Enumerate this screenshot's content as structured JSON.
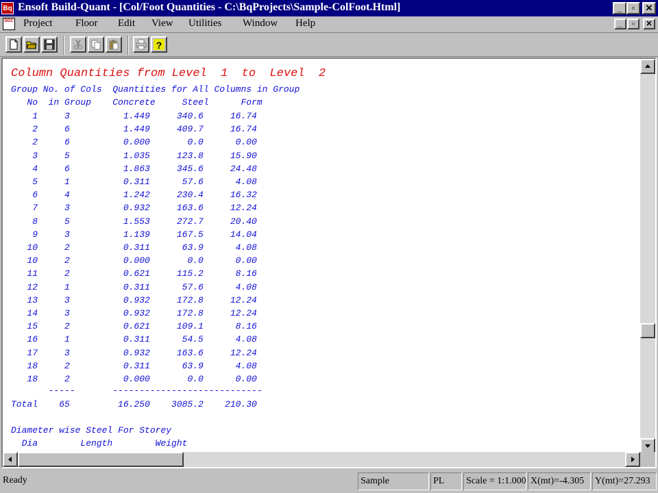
{
  "window": {
    "app_icon_label": "Bq",
    "title": "Ensoft Build-Quant - [Col/Foot Quantities - C:\\BqProjects\\Sample-ColFoot.Html]",
    "minimize": "_",
    "restore": "▫",
    "close": "✕"
  },
  "menu": {
    "doc_icon_label": "DOC",
    "items": [
      "Project",
      "Floor",
      "Edit",
      "View",
      "Utilities",
      "Window",
      "Help"
    ]
  },
  "toolbar": {
    "buttons": [
      "new-icon",
      "open-icon",
      "save-icon",
      "cut-icon",
      "copy-icon",
      "paste-icon",
      "print-icon",
      "help-icon"
    ]
  },
  "report": {
    "heading": "Column Quantities from Level  1  to  Level  2",
    "header1": "Group No. of Cols  Quantities for All Columns in Group",
    "header2": "   No  in Group    Concrete     Steel      Form",
    "rows": [
      "    1     3          1.449     340.6     16.74",
      "    2     6          1.449     409.7     16.74",
      "    2     6          0.000       0.0      0.00",
      "    3     5          1.035     123.8     15.90",
      "    4     6          1.863     345.6     24.48",
      "    5     1          0.311      57.6      4.08",
      "    6     4          1.242     230.4     16.32",
      "    7     3          0.932     163.6     12.24",
      "    8     5          1.553     272.7     20.40",
      "    9     3          1.139     167.5     14.04",
      "   10     2          0.311      63.9      4.08",
      "   10     2          0.000       0.0      0.00",
      "   11     2          0.621     115.2      8.16",
      "   12     1          0.311      57.6      4.08",
      "   13     3          0.932     172.8     12.24",
      "   14     3          0.932     172.8     12.24",
      "   15     2          0.621     109.1      8.16",
      "   16     1          0.311      54.5      4.08",
      "   17     3          0.932     163.6     12.24",
      "   18     2          0.311      63.9      4.08",
      "   18     2          0.000       0.0      0.00"
    ],
    "separator": "       -----       ----------------------------",
    "total": "Total    65         16.250    3085.2    210.30",
    "diameter_heading": "Diameter wise Steel For Storey",
    "diameter_columns": "  Dia        Length        Weight"
  },
  "status": {
    "ready": "Ready",
    "file": "Sample",
    "unit": "PL",
    "scale": "Scale = 1:1.000",
    "x": "X(mt)=-4.305",
    "y": "Y(mt)=27.293"
  },
  "colors": {
    "title_bar": "#000080",
    "heading_text": "#e01010",
    "report_text": "#1010d8"
  }
}
